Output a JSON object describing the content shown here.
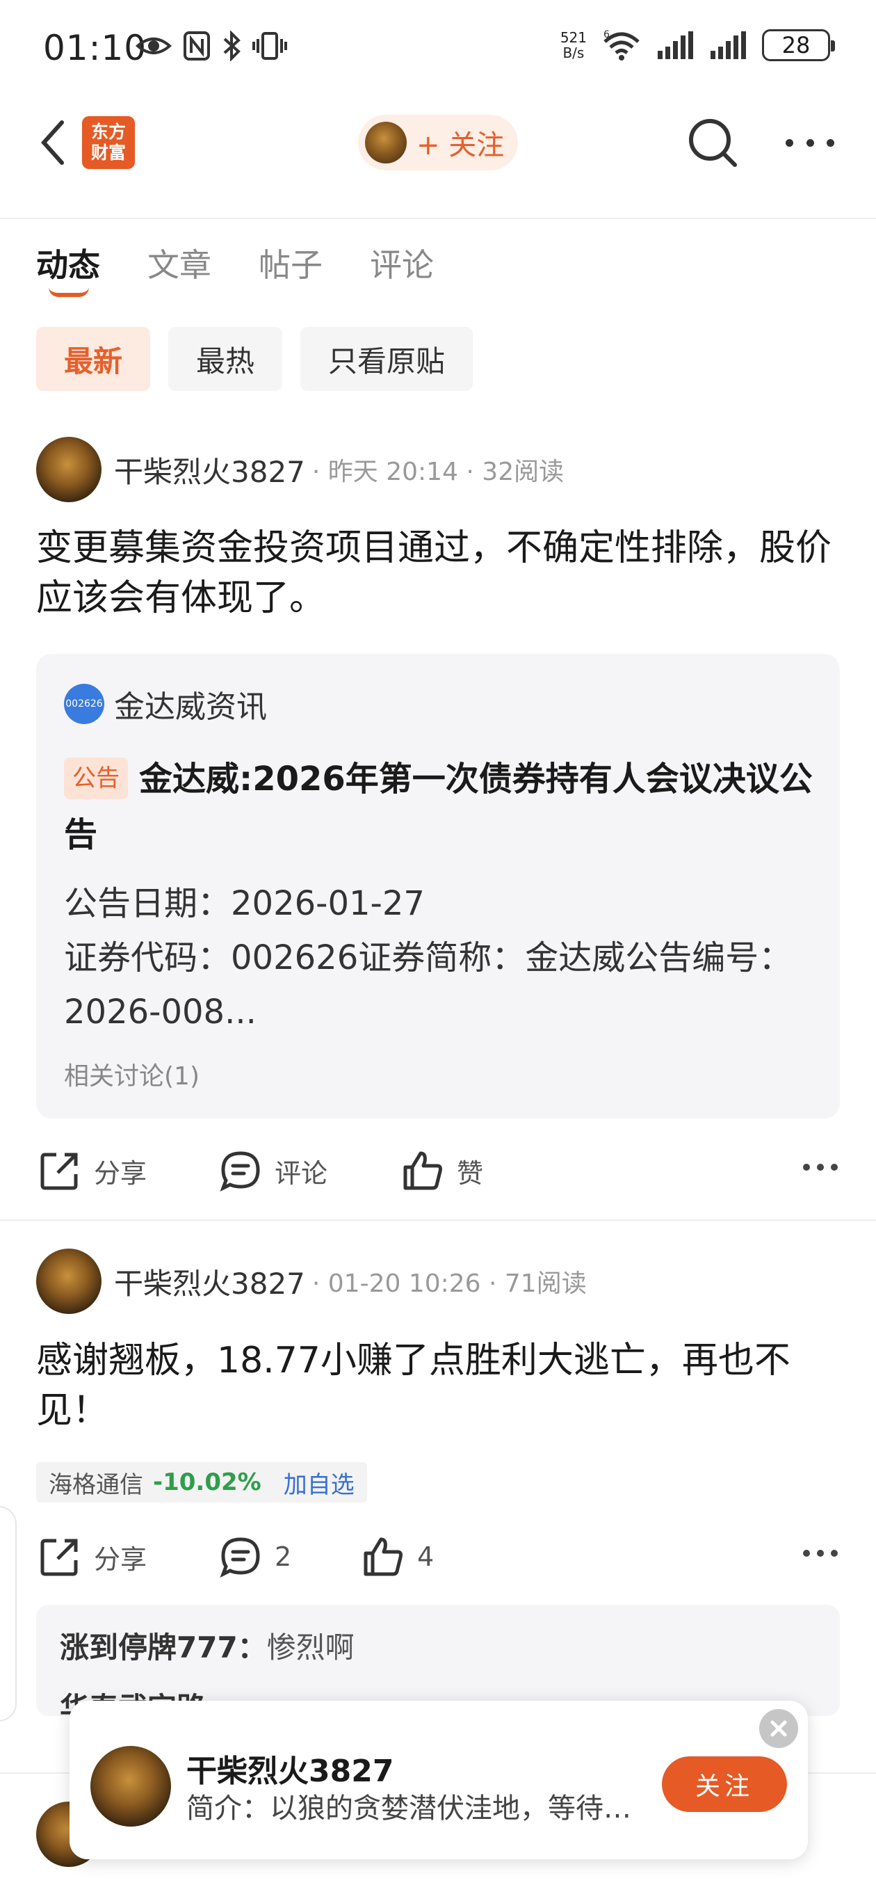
{
  "status_bar": {
    "time": "01:10",
    "net_speed_value": "521",
    "net_speed_unit": "B/s",
    "wifi_badge": "6",
    "battery": "28"
  },
  "header": {
    "logo_line1": "东方",
    "logo_line2": "财富",
    "follow_label": "+ 关注"
  },
  "tabs": [
    {
      "label": "动态",
      "active": true
    },
    {
      "label": "文章",
      "active": false
    },
    {
      "label": "帖子",
      "active": false
    },
    {
      "label": "评论",
      "active": false
    }
  ],
  "filters": [
    {
      "label": "最新",
      "active": true
    },
    {
      "label": "最热",
      "active": false
    },
    {
      "label": "只看原贴",
      "active": false
    }
  ],
  "posts": [
    {
      "author": "干柴烈火3827",
      "meta": "· 昨天 20:14 · 32阅读",
      "text": "变更募集资金投资项目通过，不确定性排除，股价应该会有体现了。",
      "card": {
        "source_logo_text": "002626",
        "source_name": "金达威资讯",
        "badge": "公告",
        "title": "金达威:2026年第一次债券持有人会议决议公告",
        "body_line1": "公告日期：2026-01-27",
        "body_line2": "证券代码：002626证券简称：金达威公告编号：2026-008...",
        "related": "相关讨论(1)"
      },
      "actions": {
        "share": "分享",
        "comment": "评论",
        "like": "赞"
      }
    },
    {
      "author": "干柴烈火3827",
      "meta": "· 01-20 10:26 · 71阅读",
      "text": "感谢翘板，18.77小赚了点胜利大逃亡，再也不见！",
      "stock": {
        "name": "海格通信",
        "change": "-10.02%",
        "add": "加自选"
      },
      "actions": {
        "share": "分享",
        "comment": "2",
        "like": "4"
      },
      "comments": [
        {
          "user": "涨到停牌777：",
          "text": "惨烈啊"
        },
        {
          "user": "华泰武定路",
          "text": ""
        }
      ]
    }
  ],
  "popup": {
    "name": "干柴烈火3827",
    "bio": "简介：以狼的贪婪潜伏洼地，等待…",
    "follow": "关注"
  },
  "colors": {
    "accent": "#e55a25",
    "stock_down": "#2f9e4b",
    "link_blue": "#3a6fd0"
  }
}
